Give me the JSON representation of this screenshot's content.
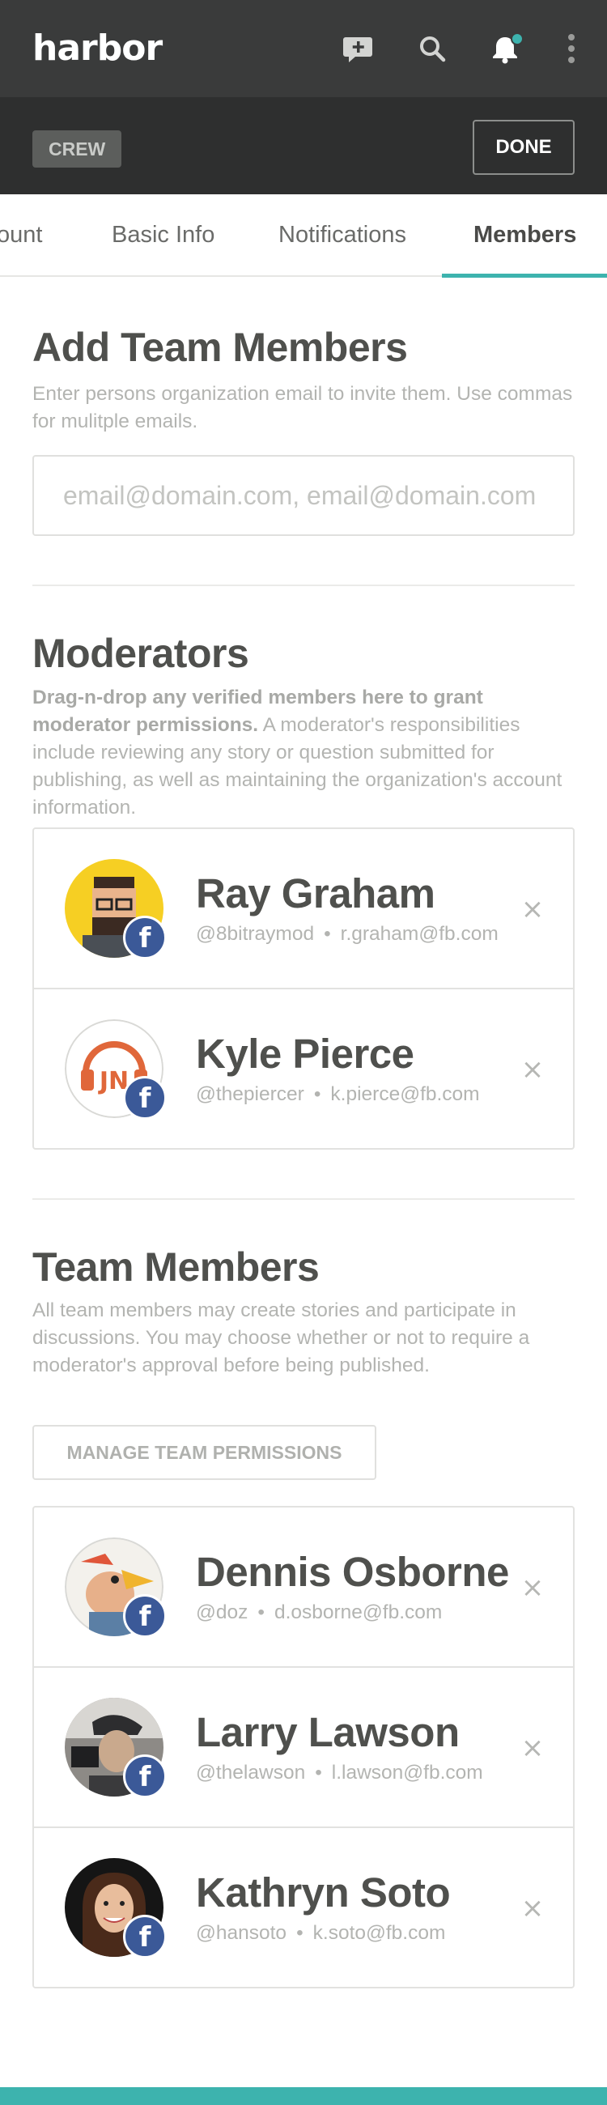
{
  "app": {
    "logo": "harbor"
  },
  "topbar": {
    "icons": [
      "compose-icon",
      "search-icon",
      "bell-icon",
      "more-vertical-icon"
    ],
    "notification_dot_color": "#3db3ae"
  },
  "subbar": {
    "tag": "CREW",
    "done_label": "DONE"
  },
  "tabs": [
    {
      "label": "ount",
      "active": false
    },
    {
      "label": "Basic Info",
      "active": false
    },
    {
      "label": "Notifications",
      "active": false
    },
    {
      "label": "Members",
      "active": true
    }
  ],
  "add_members": {
    "title": "Add Team Members",
    "description": "Enter persons organization email to invite them. Use commas for mulitple emails.",
    "input_placeholder": "email@domain.com, email@domain.com",
    "input_value": ""
  },
  "moderators": {
    "title": "Moderators",
    "description_bold": "Drag-n-drop any verified members here to grant moderator permissions.",
    "description_rest": " A moderator's responsibilities include reviewing any story or question submitted for publishing, as well as maintaining the organization's account information.",
    "members": [
      {
        "name": "Ray Graham",
        "handle": "@8bitraymod",
        "email": "r.graham@fb.com"
      },
      {
        "name": "Kyle Pierce",
        "handle": "@thepiercer",
        "email": "k.pierce@fb.com"
      }
    ]
  },
  "team": {
    "title": "Team Members",
    "description": "All team members may create stories and participate in discussions. You may choose whether or not to require a moderator's approval before being published.",
    "manage_button": "MANAGE TEAM PERMISSIONS",
    "members": [
      {
        "name": "Dennis Osborne",
        "handle": "@doz",
        "email": "d.osborne@fb.com"
      },
      {
        "name": "Larry Lawson",
        "handle": "@thelawson",
        "email": "l.lawson@fb.com"
      },
      {
        "name": "Kathryn Soto",
        "handle": "@hansoto",
        "email": "k.soto@fb.com"
      }
    ]
  },
  "common": {
    "separator": "•",
    "remove_glyph": "×",
    "fb_glyph": "f"
  },
  "colors": {
    "accent": "#3db3ae",
    "topbar": "#3a3b3b",
    "subbar": "#2e2f2f",
    "facebook": "#3b5998"
  }
}
